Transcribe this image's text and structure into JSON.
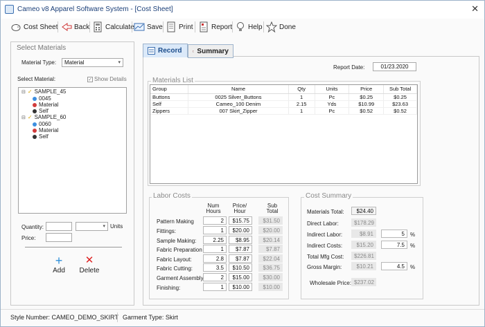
{
  "window": {
    "title": "Cameo v8 Apparel Software System - [Cost Sheet]",
    "close": "✕"
  },
  "toolbar": {
    "cost_sheet": "Cost Sheet",
    "back": "Back",
    "calculate": "Calculate",
    "save": "Save",
    "print": "Print",
    "report": "Report",
    "help": "Help",
    "done": "Done"
  },
  "left": {
    "group_title": "Select Materials",
    "material_type_label": "Material Type:",
    "material_type_value": "Material",
    "select_material_label": "Select Material:",
    "show_details": "Show Details",
    "tree": [
      {
        "label": "SAMPLE_45",
        "children": [
          "0045",
          "Material",
          "Self"
        ]
      },
      {
        "label": "SAMPLE_60",
        "children": [
          "0060",
          "Material",
          "Self"
        ]
      }
    ],
    "quantity_label": "Quantity:",
    "units_label": "Units",
    "price_label": "Price:",
    "add": "Add",
    "delete": "Delete"
  },
  "tabs": {
    "record": "Record",
    "summary": "Summary"
  },
  "record": {
    "report_date_label": "Report Date:",
    "report_date": "01/23.2020",
    "materials_list_title": "Materials List",
    "columns": [
      "Group",
      "Name",
      "Qty",
      "Units",
      "Price",
      "Sub Total"
    ],
    "rows": [
      [
        "Buttons",
        "0025 Silver_Buttons",
        "1",
        "Pc",
        "$0.25",
        "$0.25"
      ],
      [
        "Self",
        "Cameo_100 Denim",
        "2.15",
        "Yds",
        "$10.99",
        "$23.63"
      ],
      [
        "Zippers",
        "007 Skirt_Zipper",
        "1",
        "Pc",
        "$0.52",
        "$0.52"
      ]
    ]
  },
  "labor": {
    "title": "Labor Costs",
    "col_num": "Num",
    "col_hours": "Hours",
    "col_price": "Price/",
    "col_hour": "Hour",
    "col_sub": "Sub",
    "col_total": "Total",
    "rows": [
      {
        "label": "Pattern Making",
        "hours": "2",
        "price": "$15.75",
        "sub": "$31.50"
      },
      {
        "label": "Fittings:",
        "hours": "1",
        "price": "$20.00",
        "sub": "$20.00"
      },
      {
        "label": "Sample Making:",
        "hours": "2.25",
        "price": "$8.95",
        "sub": "$20.14"
      },
      {
        "label": "Fabric Preparation",
        "hours": "1",
        "price": "$7.87",
        "sub": "$7.87"
      },
      {
        "label": "Fabric Layout:",
        "hours": "2.8",
        "price": "$7.87",
        "sub": "$22.04"
      },
      {
        "label": "Fabric Cutting:",
        "hours": "3.5",
        "price": "$10.50",
        "sub": "$36.75"
      },
      {
        "label": "Garment Assembly:",
        "hours": "2",
        "price": "$15.00",
        "sub": "$30.00"
      },
      {
        "label": "Finishing:",
        "hours": "1",
        "price": "$10.00",
        "sub": "$10.00"
      }
    ]
  },
  "cost_summary": {
    "title": "Cost Summary",
    "materials_total_label": "Materials Total:",
    "materials_total": "$24.40",
    "direct_labor_label": "Direct Labor:",
    "direct_labor": "$178.29",
    "indirect_labor_label": "Indirect Labor:",
    "indirect_labor": "$8.91",
    "indirect_labor_pct": "5",
    "indirect_costs_label": "Indirect Costs:",
    "indirect_costs": "$15.20",
    "indirect_costs_pct": "7.5",
    "total_mfg_label": "Total Mfg Cost:",
    "total_mfg": "$226.81",
    "gross_margin_label": "Gross Margin:",
    "gross_margin": "$10.21",
    "gross_margin_pct": "4.5",
    "pct_symbol": "%",
    "wholesale_label": "Wholesale Price:",
    "wholesale": "$237.02"
  },
  "status": {
    "style_number": "Style Number: CAMEO_DEMO_SKIRT",
    "garment_type": "Garment Type: Skirt"
  }
}
